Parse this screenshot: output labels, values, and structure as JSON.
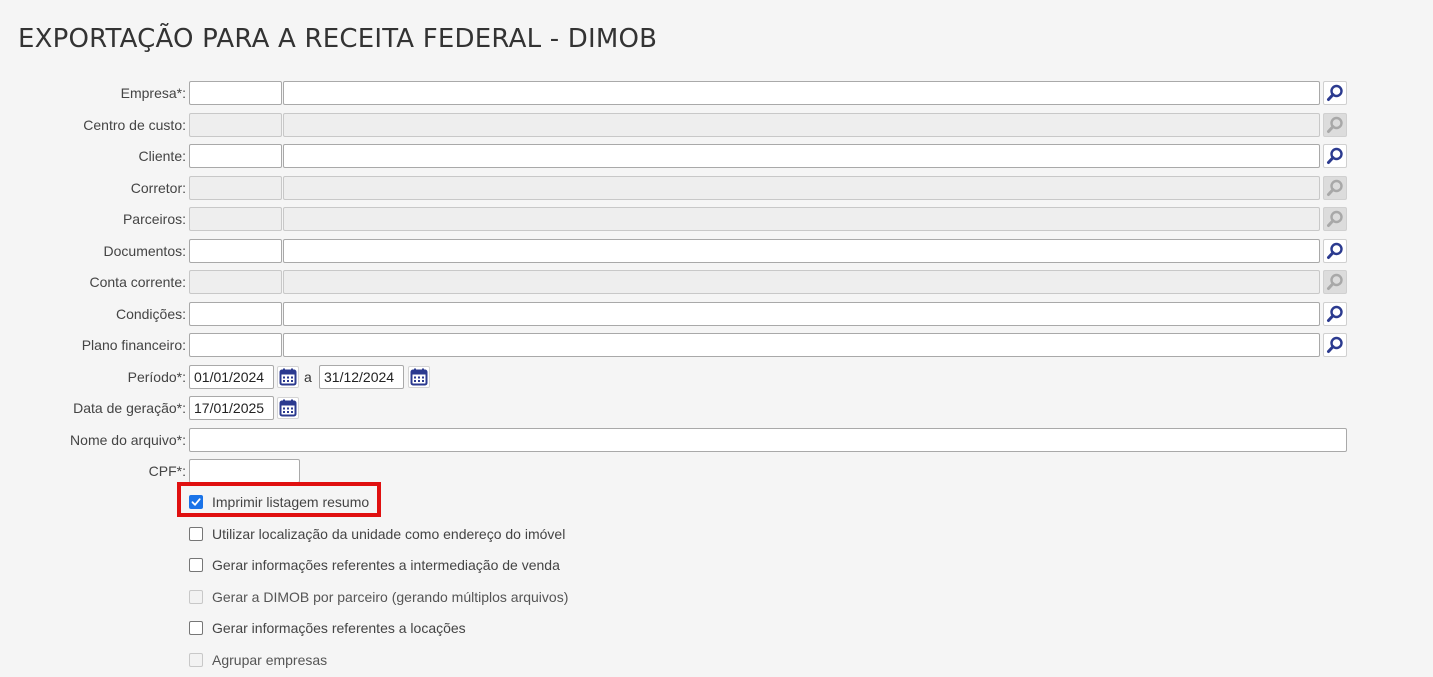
{
  "page": {
    "title": "EXPORTAÇÃO PARA A RECEITA FEDERAL - DIMOB"
  },
  "fields": {
    "empresa": {
      "label": "Empresa*:",
      "code": "",
      "description": "",
      "enabled": true
    },
    "centro_custo": {
      "label": "Centro de custo:",
      "code": "",
      "description": "",
      "enabled": false
    },
    "cliente": {
      "label": "Cliente:",
      "code": "",
      "description": "",
      "enabled": true
    },
    "corretor": {
      "label": "Corretor:",
      "code": "",
      "description": "",
      "enabled": false
    },
    "parceiros": {
      "label": "Parceiros:",
      "code": "",
      "description": "",
      "enabled": false
    },
    "documentos": {
      "label": "Documentos:",
      "code": "",
      "description": "",
      "enabled": true
    },
    "conta_corrente": {
      "label": "Conta corrente:",
      "code": "",
      "description": "",
      "enabled": false
    },
    "condicoes": {
      "label": "Condições:",
      "code": "",
      "description": "",
      "enabled": true
    },
    "plano_financeiro": {
      "label": "Plano financeiro:",
      "code": "",
      "description": "",
      "enabled": true
    }
  },
  "periodo": {
    "label": "Período*:",
    "start": "01/01/2024",
    "separator": "a",
    "end": "31/12/2024"
  },
  "data_geracao": {
    "label": "Data de geração*:",
    "value": "17/01/2025"
  },
  "nome_arquivo": {
    "label": "Nome do arquivo*:",
    "value": ""
  },
  "cpf": {
    "label": "CPF*:",
    "value": ""
  },
  "options": [
    {
      "label": "Imprimir listagem resumo",
      "checked": true,
      "enabled": true
    },
    {
      "label": "Utilizar localização da unidade como endereço do imóvel",
      "checked": false,
      "enabled": true
    },
    {
      "label": "Gerar informações referentes a intermediação de venda",
      "checked": false,
      "enabled": true
    },
    {
      "label": "Gerar a DIMOB por parceiro (gerando múltiplos arquivos)",
      "checked": false,
      "enabled": false
    },
    {
      "label": "Gerar informações referentes a locações",
      "checked": false,
      "enabled": true
    },
    {
      "label": "Agrupar empresas",
      "checked": false,
      "enabled": false
    }
  ],
  "colors": {
    "icon_active": "#2b3a8f",
    "icon_disabled": "#a8a8a8",
    "highlight": "#e01010",
    "checkbox_checked": "#1a73e8"
  },
  "icons": {
    "lookup": "magnifier-icon",
    "calendar": "calendar-icon",
    "check": "checkmark-icon"
  }
}
